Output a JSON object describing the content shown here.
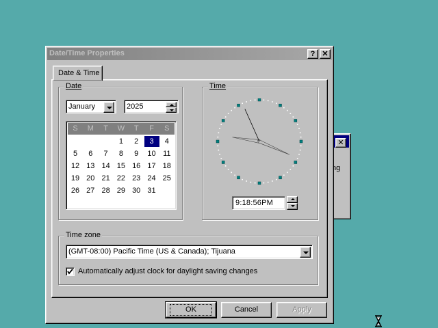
{
  "background_window": {
    "close_glyph": "✕",
    "partial_text": "ng"
  },
  "dialog": {
    "title": "Date/Time Properties",
    "help_glyph": "?",
    "close_glyph": "✕",
    "tab": "Date & Time",
    "date_group": {
      "label": "Date",
      "month": "January",
      "year": "2025",
      "day_headers": [
        "S",
        "M",
        "T",
        "W",
        "T",
        "F",
        "S"
      ],
      "selected_day": "3",
      "weeks": [
        [
          "",
          "",
          "",
          "1",
          "2",
          "3",
          "4"
        ],
        [
          "5",
          "6",
          "7",
          "8",
          "9",
          "10",
          "11"
        ],
        [
          "12",
          "13",
          "14",
          "15",
          "16",
          "17",
          "18"
        ],
        [
          "19",
          "20",
          "21",
          "22",
          "23",
          "24",
          "25"
        ],
        [
          "26",
          "27",
          "28",
          "29",
          "30",
          "31",
          ""
        ]
      ]
    },
    "time_group": {
      "label": "Time",
      "time": "9:18:56PM",
      "clock": {
        "hours": 9,
        "minutes": 18,
        "seconds": 56
      }
    },
    "timezone_group": {
      "label": "Time zone",
      "selected": "(GMT-08:00) Pacific Time (US & Canada); Tijuana",
      "auto_dst_label": "Automatically adjust clock for daylight saving changes",
      "auto_dst_checked": true
    },
    "buttons": {
      "ok": "OK",
      "cancel": "Cancel",
      "apply": "Apply"
    }
  },
  "colors": {
    "desktop": "#55aaaa",
    "face": "#c0c0c0",
    "selection": "#000080",
    "clock_dot": "#008080"
  }
}
